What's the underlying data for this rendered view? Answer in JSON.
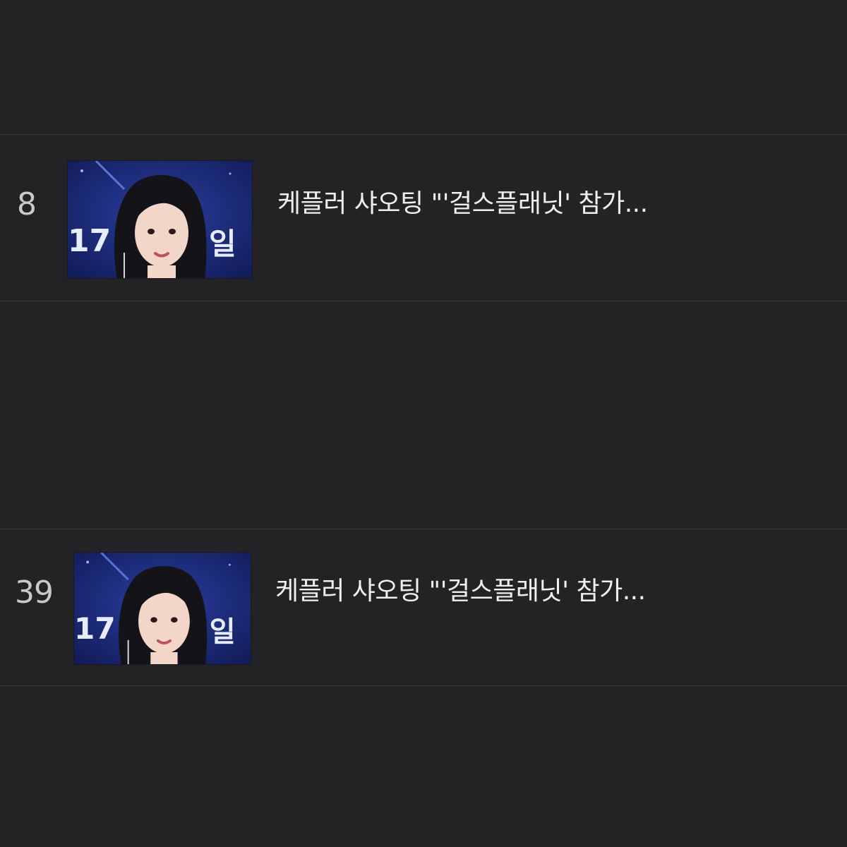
{
  "articles": [
    {
      "rank": "8",
      "title": "케플러 샤오팅 \"'걸스플래닛' 참가...",
      "thumbnail_icon": "portrait-photo"
    },
    {
      "rank": "39",
      "title": "케플러 샤오팅 \"'걸스플래닛' 참가...",
      "thumbnail_icon": "portrait-photo"
    }
  ],
  "colors": {
    "background": "#232325",
    "divider": "#3a3a3c",
    "text": "#efefef",
    "rank_text": "#c9c9c9",
    "thumbnail_bg": "#1d2f82"
  }
}
